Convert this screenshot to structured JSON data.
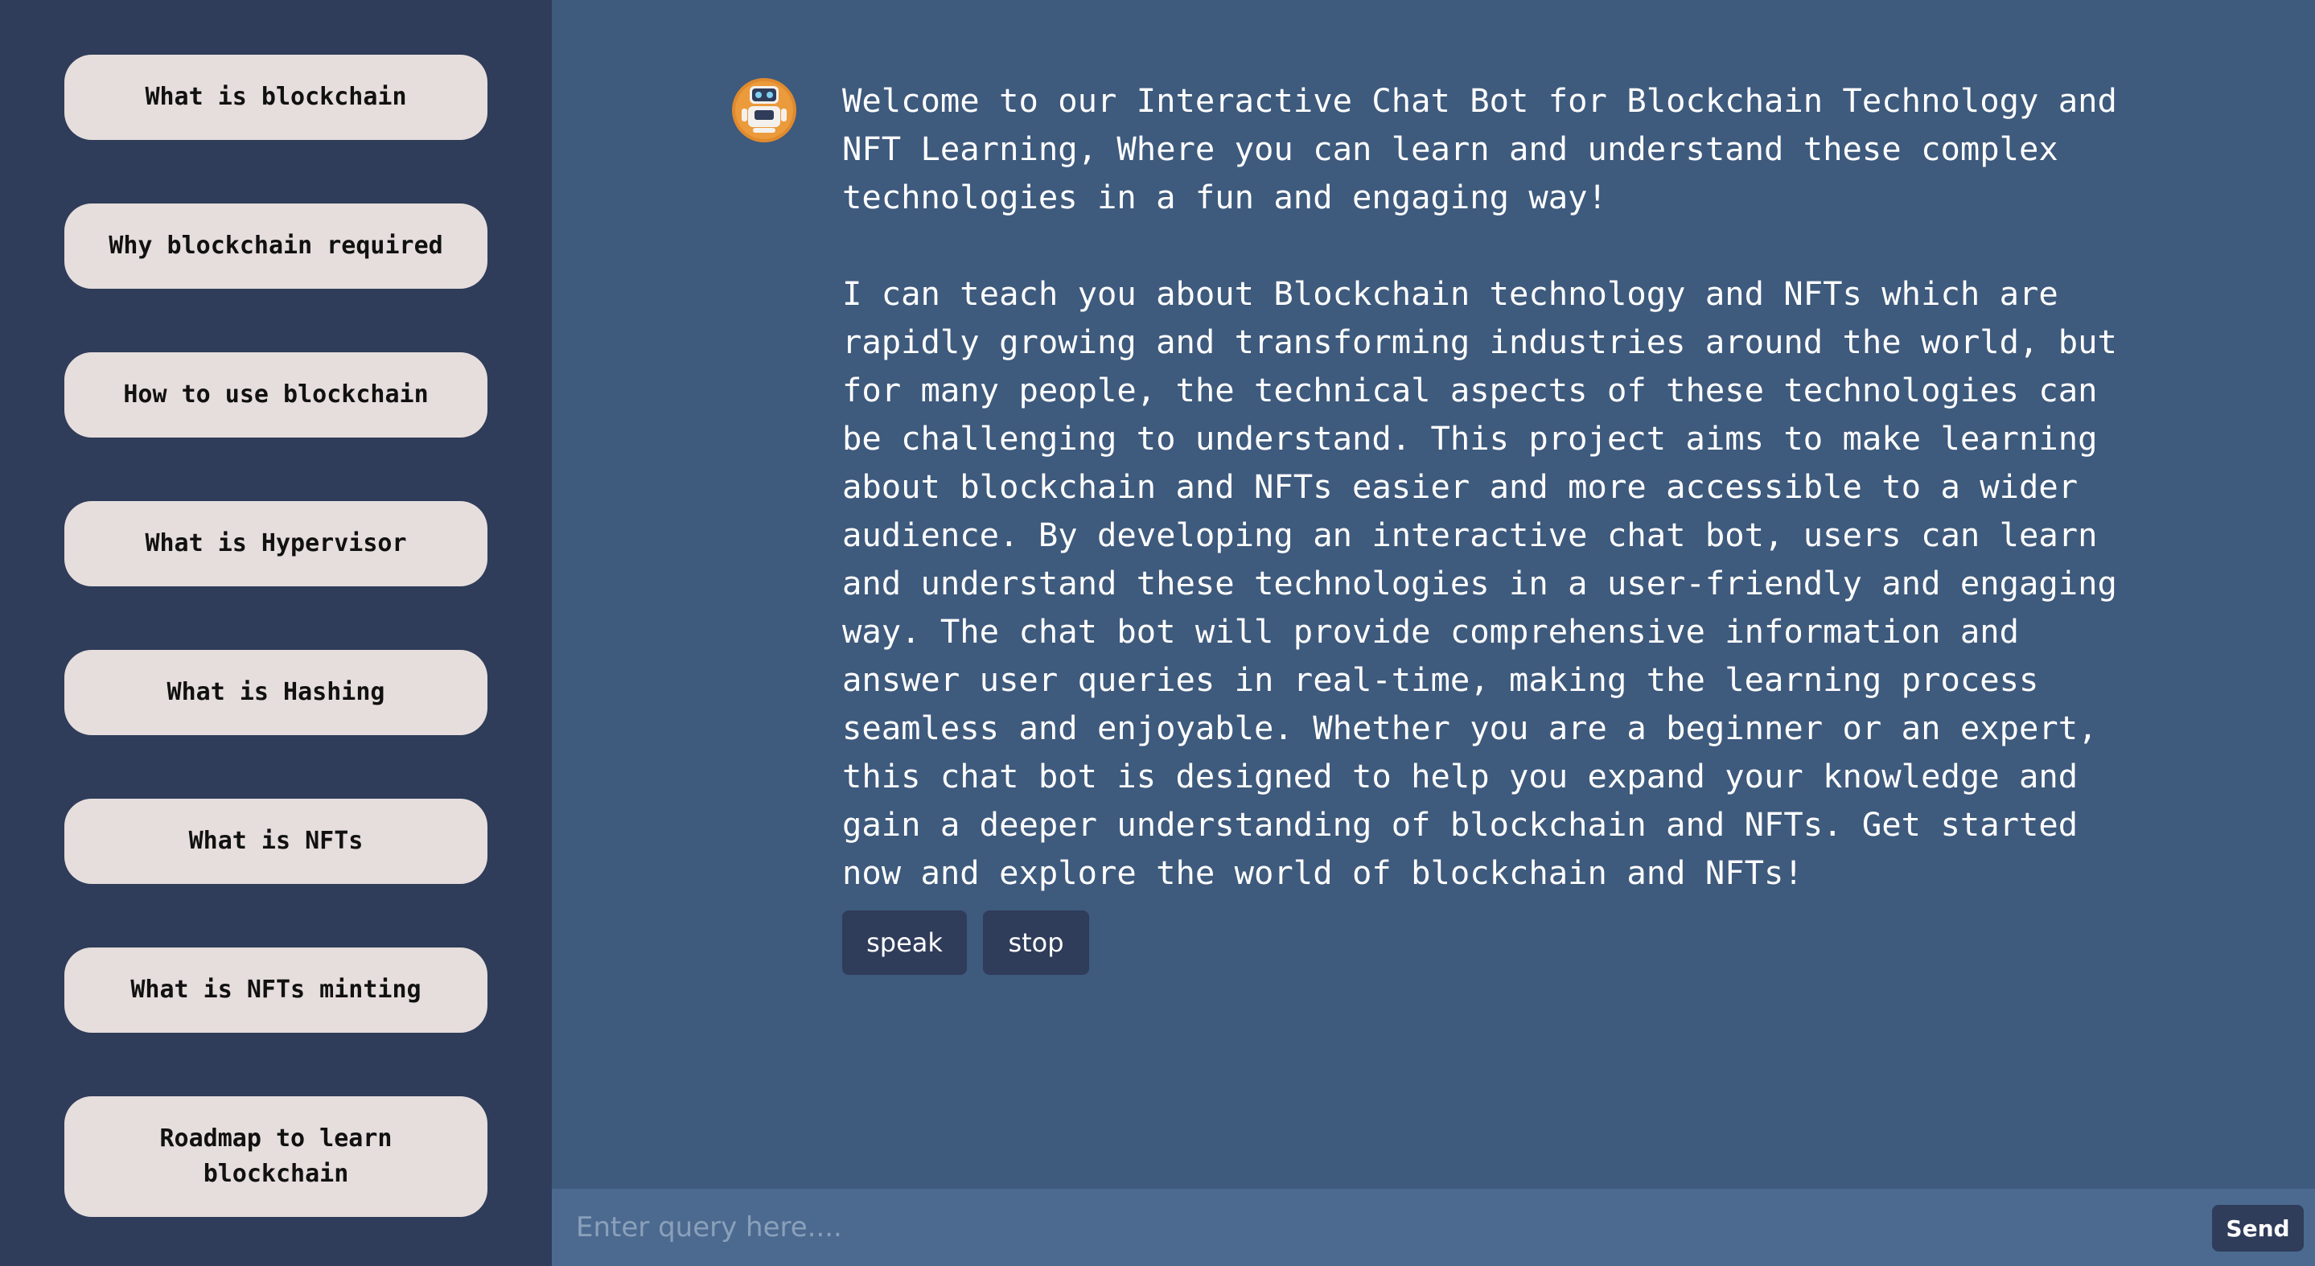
{
  "sidebar": {
    "topics": [
      {
        "label": "What is blockchain"
      },
      {
        "label": "Why blockchain required"
      },
      {
        "label": "How to use blockchain"
      },
      {
        "label": "What is Hypervisor"
      },
      {
        "label": "What is Hashing"
      },
      {
        "label": "What is NFTs"
      },
      {
        "label": "What is NFTs minting"
      },
      {
        "label": "Roadmap to learn blockchain"
      }
    ]
  },
  "chat": {
    "bot_icon": "robot-avatar-icon",
    "message": "Welcome to our Interactive Chat Bot for Blockchain Technology and\nNFT Learning, Where you can learn and understand these complex\ntechnologies in a fun and engaging way!\n\nI can teach you about Blockchain technology and NFTs which are\nrapidly growing and transforming industries around the world, but\nfor many people, the technical aspects of these technologies can\nbe challenging to understand. This project aims to make learning\nabout blockchain and NFTs easier and more accessible to a wider\naudience. By developing an interactive chat bot, users can learn\nand understand these technologies in a user-friendly and engaging\nway. The chat bot will provide comprehensive information and\nanswer user queries in real-time, making the learning process\nseamless and enjoyable. Whether you are a beginner or an expert,\nthis chat bot is designed to help you expand your knowledge and\ngain a deeper understanding of blockchain and NFTs. Get started\nnow and explore the world of blockchain and NFTs!",
    "speak_label": "speak",
    "stop_label": "stop"
  },
  "input": {
    "placeholder": "Enter query here....",
    "value": "",
    "send_label": "Send"
  },
  "colors": {
    "sidebar_bg": "#2f3c5a",
    "main_bg": "#3e5a7d",
    "input_bg": "#4c6a8f",
    "topic_button_bg": "#e6dedc",
    "accent_button_bg": "#2f3c5a",
    "avatar_orange": "#e08a2e"
  }
}
